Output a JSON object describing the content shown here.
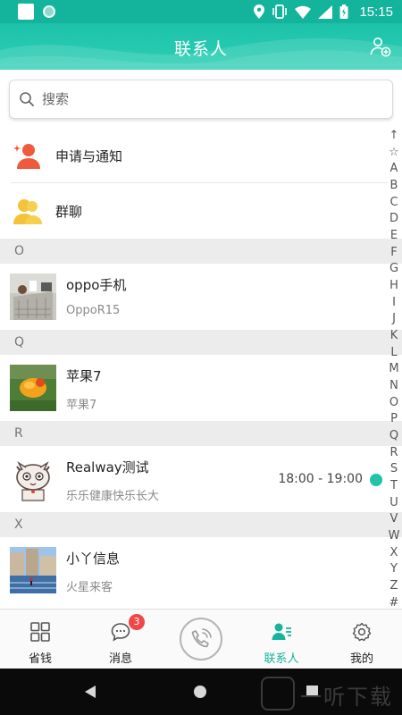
{
  "status_bar": {
    "time": "15:15"
  },
  "header": {
    "title": "联系人"
  },
  "search": {
    "placeholder": "搜索"
  },
  "top_items": [
    {
      "label": "申请与通知"
    },
    {
      "label": "群聊"
    }
  ],
  "sections": [
    {
      "letter": "O",
      "contact": {
        "name": "oppo手机",
        "subtitle": "OppoR15"
      }
    },
    {
      "letter": "Q",
      "contact": {
        "name": "苹果7",
        "subtitle": "苹果7"
      }
    },
    {
      "letter": "R",
      "contact": {
        "name": "Realway测试",
        "subtitle": "乐乐健康快乐长大",
        "time": "18:00 - 19:00",
        "online": true
      }
    },
    {
      "letter": "X",
      "contact": {
        "name": "小丫信息",
        "subtitle": "火星来客"
      }
    }
  ],
  "index_letters": [
    "↑",
    "☆",
    "A",
    "B",
    "C",
    "D",
    "E",
    "F",
    "G",
    "H",
    "I",
    "J",
    "K",
    "L",
    "M",
    "N",
    "O",
    "P",
    "Q",
    "R",
    "S",
    "T",
    "U",
    "V",
    "W",
    "X",
    "Y",
    "Z",
    "#"
  ],
  "bottom_nav": {
    "items": [
      {
        "label": "省钱"
      },
      {
        "label": "消息",
        "badge": "3"
      },
      {
        "label": ""
      },
      {
        "label": "联系人"
      },
      {
        "label": "我的"
      }
    ]
  },
  "watermark": {
    "text": "一听下载"
  },
  "colors": {
    "accent": "#17b39d",
    "badge": "#f04747",
    "online": "#22c3a6"
  }
}
